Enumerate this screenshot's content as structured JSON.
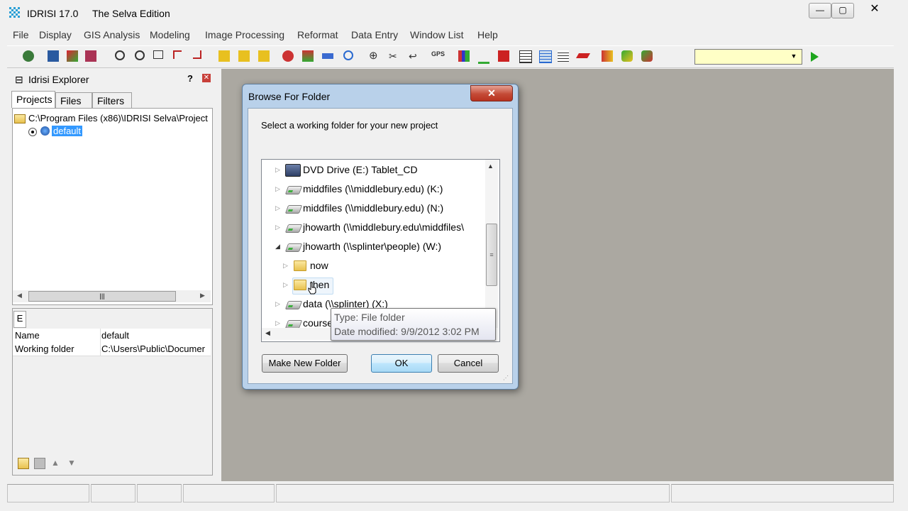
{
  "window": {
    "title": "IDRISI 17.0",
    "subtitle": "The Selva Edition",
    "minimize": "—",
    "maximize": "▢",
    "close": "✕"
  },
  "menu": [
    "File",
    "Display",
    "GIS Analysis",
    "Modeling",
    "Image Processing",
    "Reformat",
    "Data Entry",
    "Window List",
    "Help"
  ],
  "explorer": {
    "title": "Idrisi Explorer",
    "tabs": [
      "Projects",
      "Files",
      "Filters"
    ],
    "root_path": "C:\\Program Files (x86)\\IDRISI Selva\\Project",
    "selected_project": "default",
    "props_tab": "E",
    "properties": [
      {
        "key": "Name",
        "value": "default"
      },
      {
        "key": "Working folder",
        "value": "C:\\Users\\Public\\Documer"
      }
    ]
  },
  "dialog": {
    "title": "Browse For Folder",
    "prompt": "Select a working folder for your new project",
    "tree": [
      {
        "label": "DVD Drive (E:) Tablet_CD",
        "icon": "dvd-drive-icon",
        "expanded": false,
        "indent": 0
      },
      {
        "label": "middfiles (\\\\middlebury.edu) (K:)",
        "icon": "network-drive-icon",
        "expanded": false,
        "indent": 0
      },
      {
        "label": "middfiles (\\\\middlebury.edu) (N:)",
        "icon": "network-drive-icon",
        "expanded": false,
        "indent": 0
      },
      {
        "label": "jhowarth (\\\\middlebury.edu\\middfiles\\",
        "icon": "network-drive-icon",
        "expanded": false,
        "indent": 0
      },
      {
        "label": "jhowarth (\\\\splinter\\people) (W:)",
        "icon": "network-drive-icon",
        "expanded": true,
        "indent": 0
      },
      {
        "label": "now",
        "icon": "folder-icon",
        "expanded": false,
        "indent": 1
      },
      {
        "label": "then",
        "icon": "folder-icon",
        "expanded": false,
        "indent": 1,
        "hovered": true
      },
      {
        "label": "data (\\\\splinter) (X:)",
        "icon": "network-drive-icon",
        "expanded": false,
        "indent": 0
      },
      {
        "label": "course",
        "icon": "network-drive-icon",
        "expanded": false,
        "indent": 0
      }
    ],
    "tooltip": {
      "type": "Type: File folder",
      "date": "Date modified: 9/9/2012 3:02 PM"
    },
    "buttons": {
      "make_new_folder": "Make New Folder",
      "ok": "OK",
      "cancel": "Cancel"
    }
  },
  "colors": {
    "workspace": "#aba8a1",
    "selection": "#3399ff",
    "toolbar_combo": "#ffffc6",
    "dialog_frame": "#b9d1ea"
  }
}
